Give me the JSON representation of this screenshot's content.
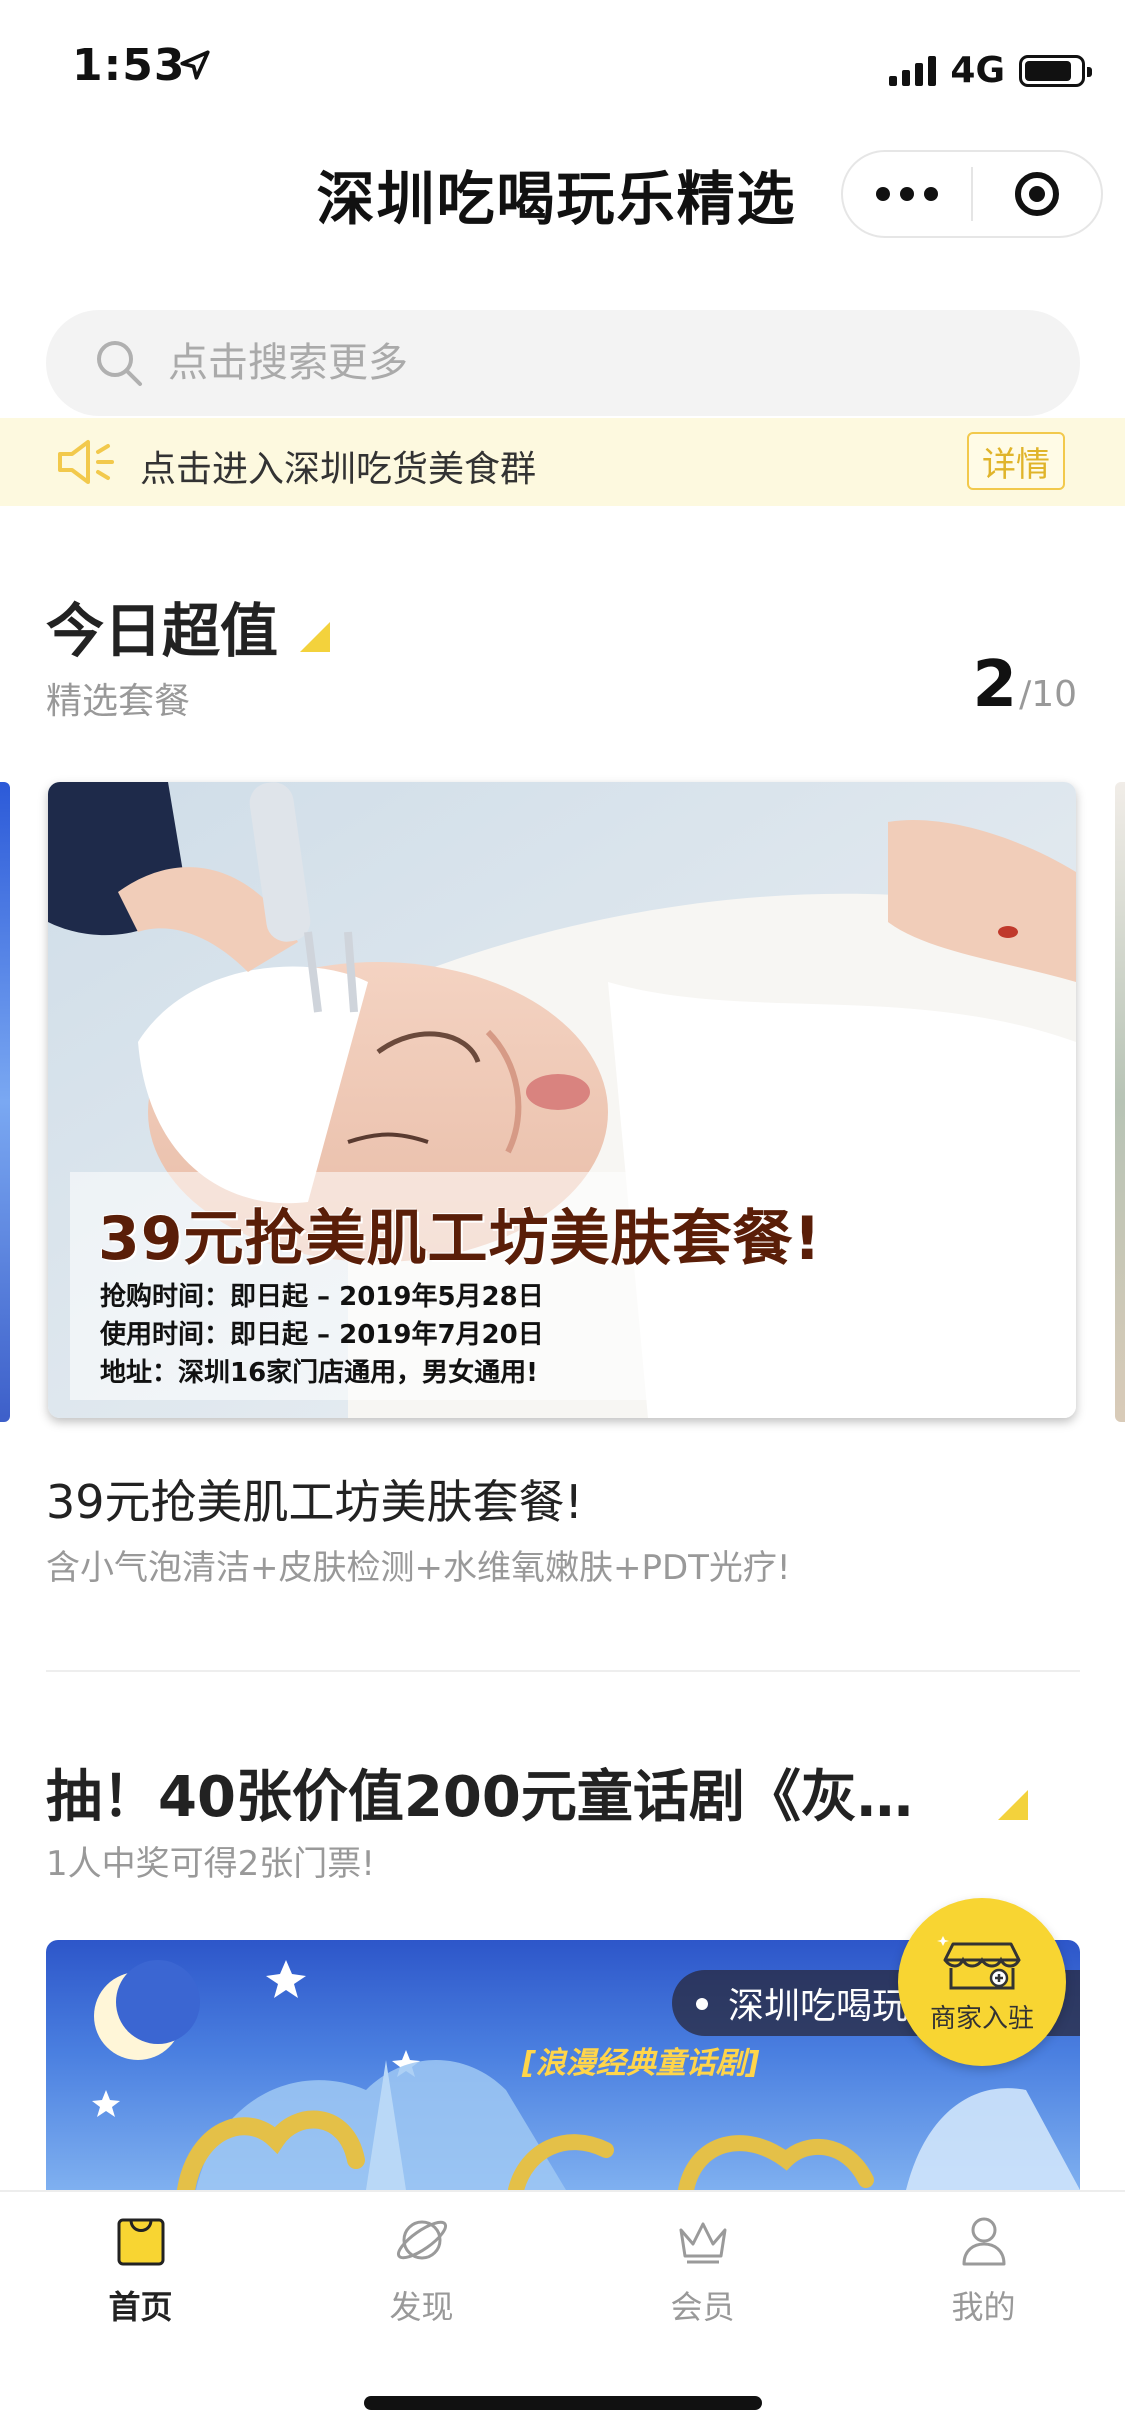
{
  "status_bar": {
    "time": "1:53",
    "network": "4G"
  },
  "header": {
    "title": "深圳吃喝玩乐精选"
  },
  "search": {
    "placeholder": "点击搜索更多"
  },
  "notice": {
    "text": "点击进入深圳吃货美食群",
    "button": "详情"
  },
  "section_deals": {
    "title": "今日超值",
    "subtitle": "精选套餐",
    "counter_current": "2",
    "counter_total": "/10",
    "card": {
      "image_title": "39元抢美肌工坊美肤套餐!",
      "image_lines": [
        "抢购时间：即日起 – 2019年5月28日",
        "使用时间：即日起 – 2019年7月20日",
        "地址：深圳16家门店通用，男女通用!"
      ],
      "title": "39元抢美肌工坊美肤套餐!",
      "description": "含小气泡清洁+皮肤检测+水维氧嫩肤+PDT光疗!"
    }
  },
  "section_lottery": {
    "title": "抽！40张价值200元童话剧《灰…",
    "subtitle": "1人中奖可得2张门票!",
    "banner_tag": "深圳吃喝玩",
    "banner_subtitle": "[浪漫经典童话剧]"
  },
  "merchant_fab": {
    "label": "商家入驻"
  },
  "tabbar": {
    "items": [
      {
        "label": "首页",
        "icon": "home-bag-icon"
      },
      {
        "label": "发现",
        "icon": "planet-icon"
      },
      {
        "label": "会员",
        "icon": "crown-icon"
      },
      {
        "label": "我的",
        "icon": "user-icon"
      }
    ]
  },
  "colors": {
    "accent": "#f8d532",
    "notice_bg": "#fdf9df"
  }
}
